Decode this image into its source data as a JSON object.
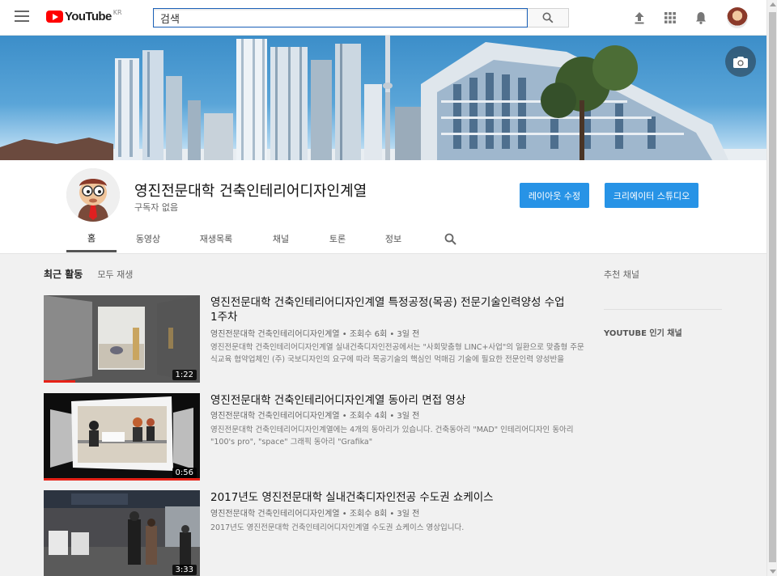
{
  "header": {
    "logo_text": "YouTube",
    "logo_region": "KR",
    "search_placeholder": "검색",
    "search_value": "검색"
  },
  "colors": {
    "accent": "#2793e6",
    "brand_red": "#ff0000",
    "progress_red": "#e62117"
  },
  "icons": [
    "menu-icon",
    "search-icon",
    "upload-icon",
    "apps-icon",
    "bell-icon",
    "camera-icon"
  ],
  "channel": {
    "title": "영진전문대학 건축인테리어디자인계열",
    "subscribers": "구독자 없음",
    "edit_layout_label": "레이아웃 수정",
    "creator_studio_label": "크리에이터 스튜디오"
  },
  "tabs": [
    {
      "label": "홈",
      "active": true
    },
    {
      "label": "동영상"
    },
    {
      "label": "재생목록"
    },
    {
      "label": "채널"
    },
    {
      "label": "토론"
    },
    {
      "label": "정보"
    }
  ],
  "section": {
    "title": "최근 활동",
    "play_all": "모두 재생"
  },
  "videos": [
    {
      "title": "영진전문대학 건축인테리어디자인계열 특정공정(목공) 전문기술인력양성 수업 1주차",
      "meta": "영진전문대학 건축인테리어디자인계열 • 조회수 6회 • 3일 전",
      "desc": "영진전문대학 건축인테리어디자인계열 실내건축디자인전공에서는 \"사회맞춤형 LINC+사업\"의 일환으로 맞춤형 주문식교육 협약업체인 (주) 국보디자인의 요구에 따라 목공기술의 핵심인 먹매김 기술에 필요한 전문인력 양성반을",
      "duration": "1:22",
      "progress": 0.2
    },
    {
      "title": "영진전문대학 건축인테리어디자인계열 동아리 면접 영상",
      "meta": "영진전문대학 건축인테리어디자인계열 • 조회수 4회 • 3일 전",
      "desc": "영진전문대학 건축인테리어디자인계열에는 4개의 동아리가 있습니다. 건축동아리 \"MAD\" 인테리어디자인 동아리 \"100's pro\", \"space\" 그래픽 동아리 \"Grafika\"",
      "duration": "0:56",
      "progress": 1.0
    },
    {
      "title": "2017년도 영진전문대학 실내건축디자인전공 수도권 쇼케이스",
      "meta": "영진전문대학 건축인테리어디자인계열 • 조회수 8회 • 3일 전",
      "desc": "2017년도 영진전문대학 건축인테리어디자인계열 수도권 쇼케이스 영상입니다.",
      "duration": "3:33",
      "progress": 0
    }
  ],
  "sidebar": {
    "recommended_title": "추천 채널",
    "popular_title": "YOUTUBE 인기 채널"
  }
}
